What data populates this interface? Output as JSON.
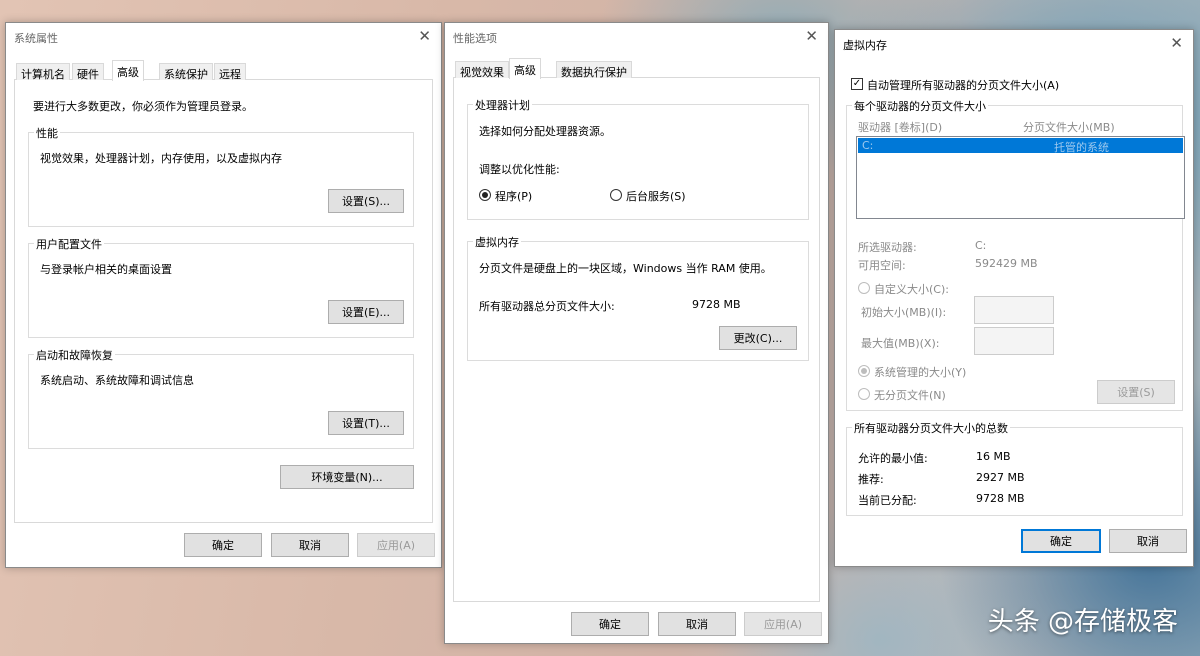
{
  "sysprop": {
    "title": "系统属性",
    "tabs": [
      "计算机名",
      "硬件",
      "高级",
      "系统保护",
      "远程"
    ],
    "admin_notice": "要进行大多数更改，你必须作为管理员登录。",
    "perf_label": "性能",
    "perf_desc": "视觉效果，处理器计划，内存使用，以及虚拟内存",
    "perf_button": "设置(S)...",
    "profile_label": "用户配置文件",
    "profile_desc": "与登录帐户相关的桌面设置",
    "profile_button": "设置(E)...",
    "startup_label": "启动和故障恢复",
    "startup_desc": "系统启动、系统故障和调试信息",
    "startup_button": "设置(T)...",
    "env_button": "环境变量(N)...",
    "ok": "确定",
    "cancel": "取消",
    "apply": "应用(A)"
  },
  "perfopt": {
    "title": "性能选项",
    "tabs": [
      "视觉效果",
      "高级",
      "数据执行保护"
    ],
    "sched_label": "处理器计划",
    "sched_desc": "选择如何分配处理器资源。",
    "adjust_label": "调整以优化性能:",
    "radio_programs": "程序(P)",
    "radio_services": "后台服务(S)",
    "vm_label": "虚拟内存",
    "vm_desc": "分页文件是硬盘上的一块区域，Windows 当作 RAM 使用。",
    "vm_total_label": "所有驱动器总分页文件大小:",
    "vm_total_value": "9728 MB",
    "change_button": "更改(C)...",
    "ok": "确定",
    "cancel": "取消",
    "apply": "应用(A)"
  },
  "vmem": {
    "title": "虚拟内存",
    "auto_manage": "自动管理所有驱动器的分页文件大小(A)",
    "auto_checked": true,
    "per_drive_label": "每个驱动器的分页文件大小",
    "col_drive": "驱动器 [卷标](D)",
    "col_size": "分页文件大小(MB)",
    "row_drive": "C:",
    "row_size": "托管的系统",
    "selected_drive_label": "所选驱动器:",
    "selected_drive_value": "C:",
    "free_space_label": "可用空间:",
    "free_space_value": "592429 MB",
    "custom_size": "自定义大小(C):",
    "initial_size": "初始大小(MB)(I):",
    "max_size": "最大值(MB)(X):",
    "system_managed": "系统管理的大小(Y)",
    "no_paging": "无分页文件(N)",
    "set_button": "设置(S)",
    "total_label": "所有驱动器分页文件大小的总数",
    "min_label": "允许的最小值:",
    "min_value": "16 MB",
    "recommended_label": "推荐:",
    "recommended_value": "2927 MB",
    "current_label": "当前已分配:",
    "current_value": "9728 MB",
    "ok": "确定",
    "cancel": "取消"
  },
  "watermark": "头条 @存储极客"
}
